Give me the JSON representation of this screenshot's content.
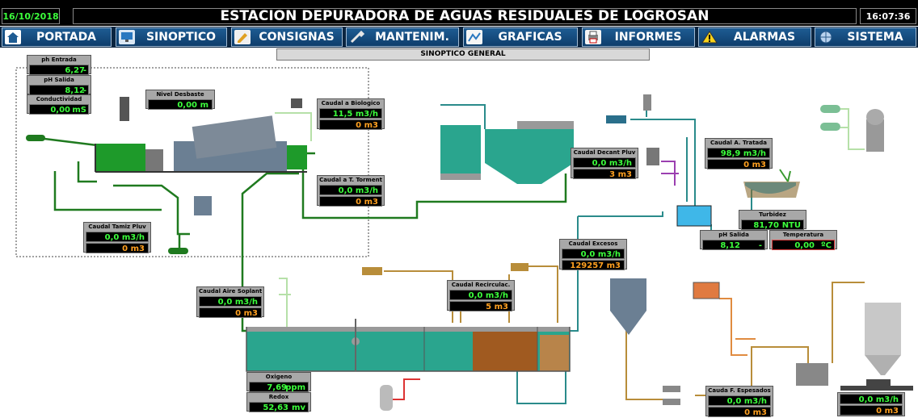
{
  "header": {
    "date": "16/10/2018",
    "title": "ESTACION DEPURADORA DE AGUAS RESIDUALES DE LOGROSAN",
    "time": "16:07:36"
  },
  "nav": [
    {
      "label": "PORTADA",
      "icon": "home-icon"
    },
    {
      "label": "SINOPTICO",
      "icon": "monitor-icon"
    },
    {
      "label": "CONSIGNAS",
      "icon": "pencil-icon"
    },
    {
      "label": "MANTENIM.",
      "icon": "wrench-icon"
    },
    {
      "label": "GRAFICAS",
      "icon": "chart-icon"
    },
    {
      "label": "INFORMES",
      "icon": "printer-icon"
    },
    {
      "label": "ALARMAS",
      "icon": "warning-icon"
    },
    {
      "label": "SISTEMA",
      "icon": "globe-icon"
    }
  ],
  "subtitle": "SINOPTICO GENERAL",
  "panels": {
    "ph_entrada": {
      "label": "ph Entrada",
      "value": "6,27",
      "unit": "-"
    },
    "ph_salida_in": {
      "label": "pH Salida",
      "value": "8,12",
      "unit": "-"
    },
    "conductividad": {
      "label": "Conductividad",
      "value": "0,00",
      "unit": "mS"
    },
    "nivel_desbaste": {
      "label": "Nivel Desbaste",
      "value": "0,00",
      "unit": "m"
    },
    "caudal_biologico": {
      "label": "Caudal a Biologico",
      "value": "11,5 m3/h",
      "total": "0 m3"
    },
    "caudal_tormenta": {
      "label": "Caudal a T. Torment",
      "value": "0,0 m3/h",
      "total": "0 m3"
    },
    "caudal_tamiz": {
      "label": "Caudal Tamiz Pluv",
      "value": "0,0 m3/h",
      "total": "0 m3"
    },
    "caudal_decant": {
      "label": "Caudal Decant Pluv",
      "value": "0,0 m3/h",
      "total": "3 m3"
    },
    "caudal_tratada": {
      "label": "Caudal A. Tratada",
      "value": "98,9 m3/h",
      "total": "0 m3"
    },
    "turbidez": {
      "label": "Turbidez",
      "value": "81,70",
      "unit": "NTU"
    },
    "ph_salida": {
      "label": "pH Salida",
      "value": "8,12",
      "unit": "-"
    },
    "temperatura": {
      "label": "Temperatura",
      "value": "0,00",
      "unit": "ºC"
    },
    "caudal_excesos": {
      "label": "Caudal Excesos",
      "value": "0,0 m3/h",
      "total": "129257 m3"
    },
    "caudal_aire": {
      "label": "Caudal Aire Soplant",
      "value": "0,0 m3/h",
      "total": "0 m3"
    },
    "caudal_recirc": {
      "label": "Caudal Recirculac.",
      "value": "0,0 m3/h",
      "total": "5 m3"
    },
    "oxigeno": {
      "label": "Oxigeno",
      "value": "7,69",
      "unit": "ppm"
    },
    "redox": {
      "label": "Redox",
      "value": "52,63",
      "unit": "mv"
    },
    "caudal_espesados": {
      "label": "Cauda F. Espesados",
      "value": "0,0 m3/h",
      "total": "0 m3"
    },
    "caudal_final": {
      "value": "0,0 m3/h",
      "total": "0 m3"
    }
  }
}
